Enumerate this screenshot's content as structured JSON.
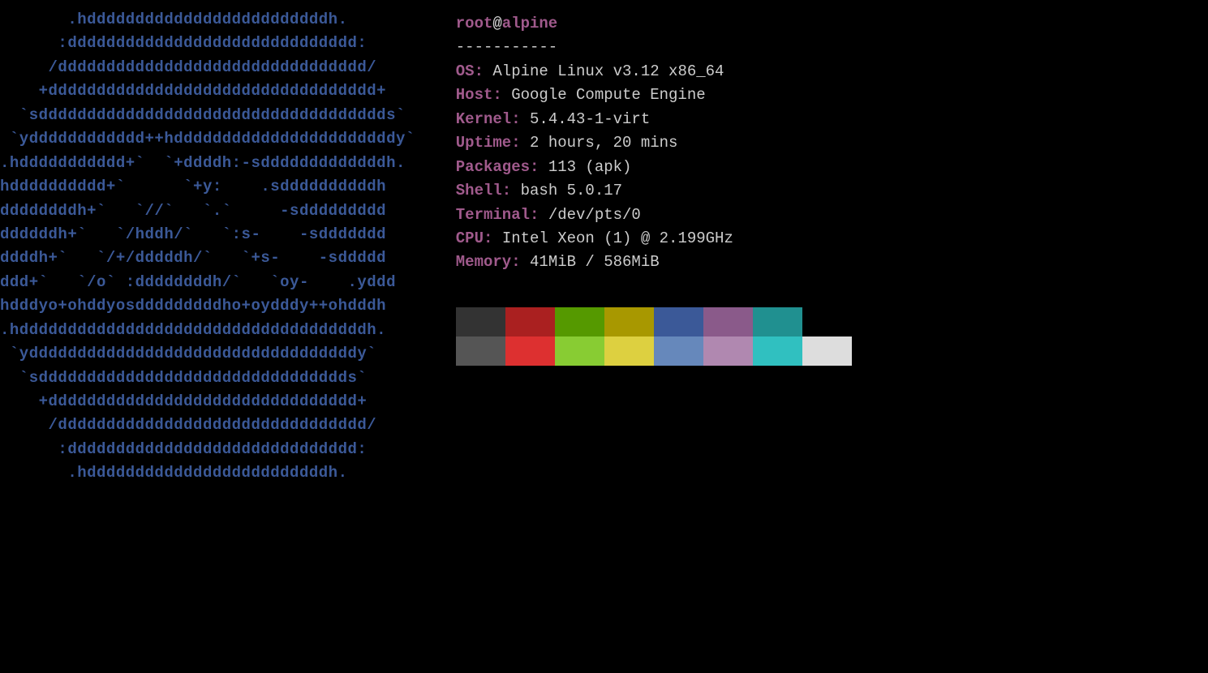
{
  "ascii_art": "       .hdddddddddddddddddddddddddh.\n      :dddddddddddddddddddddddddddddd:\n     /dddddddddddddddddddddddddddddddd/\n    +dddddddddddddddddddddddddddddddddd+\n  `sdddddddddddddddddddddddddddddddddddds`\n `ydddddddddddd++hdddddddddddddddddddddddy`\n.hddddddddddd+`  `+ddddh:-sdddddddddddddh.\nhdddddddddd+`      `+y:    .sddddddddddh\nddddddddh+`   `//`   `.`     -sddddddddd\nddddddh+`   `/hddh/`   `:s-    -sddddddd\nddddh+`   `/+/dddddh/`   `+s-    -sddddd\nddd+`   `/o` :ddddddddh/`   `oy-    .yddd\nhdddyo+ohddyosdddddddddho+oydddy++ohdddh\n.hddddddddddddddddddddddddddddddddddddh.\n `yddddddddddddddddddddddddddddddddddy`\n  `sdddddddddddddddddddddddddddddddds`\n    +dddddddddddddddddddddddddddddddd+\n     /dddddddddddddddddddddddddddddddd/\n      :dddddddddddddddddddddddddddddd:\n       .hdddddddddddddddddddddddddh.",
  "user": "root",
  "at_symbol": "@",
  "hostname": "alpine",
  "separator": "-----------",
  "info": {
    "os": {
      "label": "OS",
      "value": "Alpine Linux v3.12 x86_64"
    },
    "host": {
      "label": "Host",
      "value": "Google Compute Engine"
    },
    "kernel": {
      "label": "Kernel",
      "value": "5.4.43-1-virt"
    },
    "uptime": {
      "label": "Uptime",
      "value": "2 hours, 20 mins"
    },
    "packages": {
      "label": "Packages",
      "value": "113 (apk)"
    },
    "shell": {
      "label": "Shell",
      "value": "bash 5.0.17"
    },
    "terminal": {
      "label": "Terminal",
      "value": "/dev/pts/0"
    },
    "cpu": {
      "label": "CPU",
      "value": "Intel Xeon (1) @ 2.199GHz"
    },
    "memory": {
      "label": "Memory",
      "value": "41MiB / 586MiB"
    }
  },
  "colors": {
    "row1": [
      "#333333",
      "#aa2020",
      "#559900",
      "#a89800",
      "#3b5998",
      "#8a5a8a",
      "#209090",
      "#000000"
    ],
    "row2": [
      "#555555",
      "#dd3030",
      "#88cc33",
      "#ddd040",
      "#6688bb",
      "#b088b0",
      "#30c0c0",
      "#dddddd"
    ]
  }
}
